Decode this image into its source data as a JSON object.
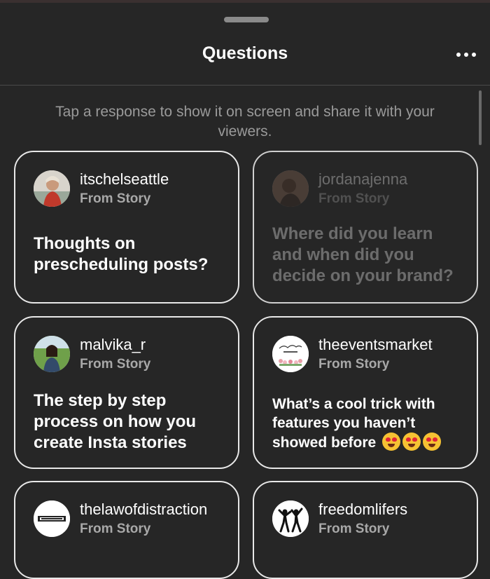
{
  "header": {
    "title": "Questions",
    "more_icon": "ellipsis-icon"
  },
  "hint": "Tap a response to show it on screen and share it with your viewers.",
  "cards": [
    {
      "username": "itschelseattle",
      "source": "From Story",
      "question": "Thoughts on prescheduling posts?",
      "avatar": "profile-photo",
      "dimmed": false
    },
    {
      "username": "jordanajenna",
      "source": "From Story",
      "question": "Where did you learn and when did you decide on your brand?",
      "avatar": "profile-photo",
      "dimmed": true
    },
    {
      "username": "malvika_r",
      "source": "From Story",
      "question": "The step by step process on how you create Insta stories",
      "avatar": "profile-photo",
      "dimmed": false
    },
    {
      "username": "theeventsmarket",
      "source": "From Story",
      "question": "What’s a cool trick with features you haven’t showed before",
      "avatar": "logo",
      "dimmed": false,
      "emoji": "heart-eyes-emoji"
    },
    {
      "username": "thelawofdistraction",
      "source": "From Story",
      "avatar": "logo",
      "dimmed": false
    },
    {
      "username": "freedomlifers",
      "source": "From Story",
      "avatar": "logo",
      "dimmed": false
    }
  ],
  "colors": {
    "background": "#262626",
    "card_border": "#e8e8e8",
    "secondary_text": "#a8a8a8",
    "hint_text": "#9a9a9a"
  }
}
